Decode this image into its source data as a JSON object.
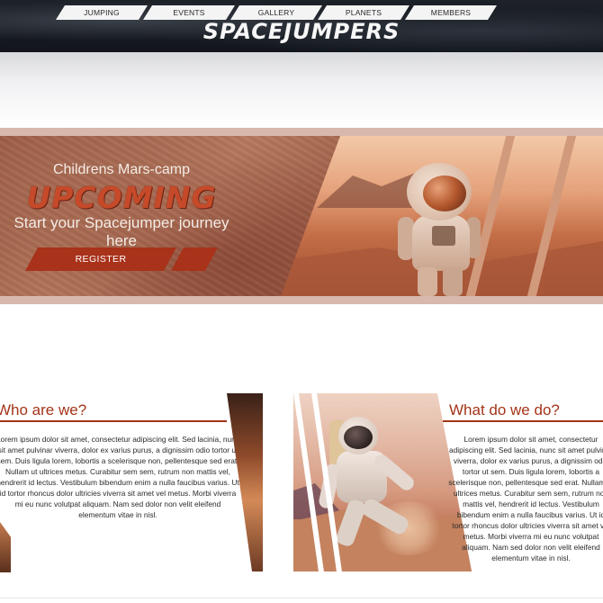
{
  "nav": {
    "items": [
      "JUMPING",
      "EVENTS",
      "GALLERY",
      "PLANETS",
      "MEMBERS"
    ]
  },
  "brand": {
    "name": "SPACEJUMPERS"
  },
  "hero": {
    "subtitle": "Childrens Mars-camp",
    "headline": "UPCOMING",
    "tagline": "Start your Spacejumper journey here",
    "register_label": "REGISTER"
  },
  "who": {
    "title": "Who are we?",
    "body": "Lorem ipsum dolor sit amet, consectetur adipiscing elit. Sed lacinia, nunc sit amet pulvinar viverra, dolor ex varius purus, a dignissim odio tortor ut sem. Duis ligula lorem, lobortis a scelerisque non, pellentesque sed erat. Nullam ut ultrices metus. Curabitur sem sem, rutrum non mattis vel, hendrerit id lectus. Vestibulum bibendum enim a nulla faucibus varius. Ut id tortor rhoncus dolor ultricies viverra sit amet vel metus. Morbi viverra mi eu nunc volutpat aliquam. Nam sed dolor non velit eleifend elementum vitae in nisl."
  },
  "what": {
    "title": "What do we do?",
    "body": "Lorem ipsum dolor sit amet, consectetur adipiscing elit. Sed lacinia, nunc sit amet pulvinar viverra, dolor ex varius purus, a dignissim odio tortor ut sem. Duis ligula lorem, lobortis a scelerisque non, pellentesque sed erat. Nullam ut ultrices metus. Curabitur sem sem, rutrum non mattis vel, hendrerit id lectus. Vestibulum bibendum enim a nulla faucibus varius. Ut id tortor rhoncus dolor ultricies viverra sit amet vel metus. Morbi viverra mi eu nunc volutpat aliquam. Nam sed dolor non velit eleifend elementum vitae in nisl."
  },
  "colors": {
    "accent": "#a33418",
    "header_bg": "#161a20",
    "nav_bg": "#f4f4f4"
  }
}
